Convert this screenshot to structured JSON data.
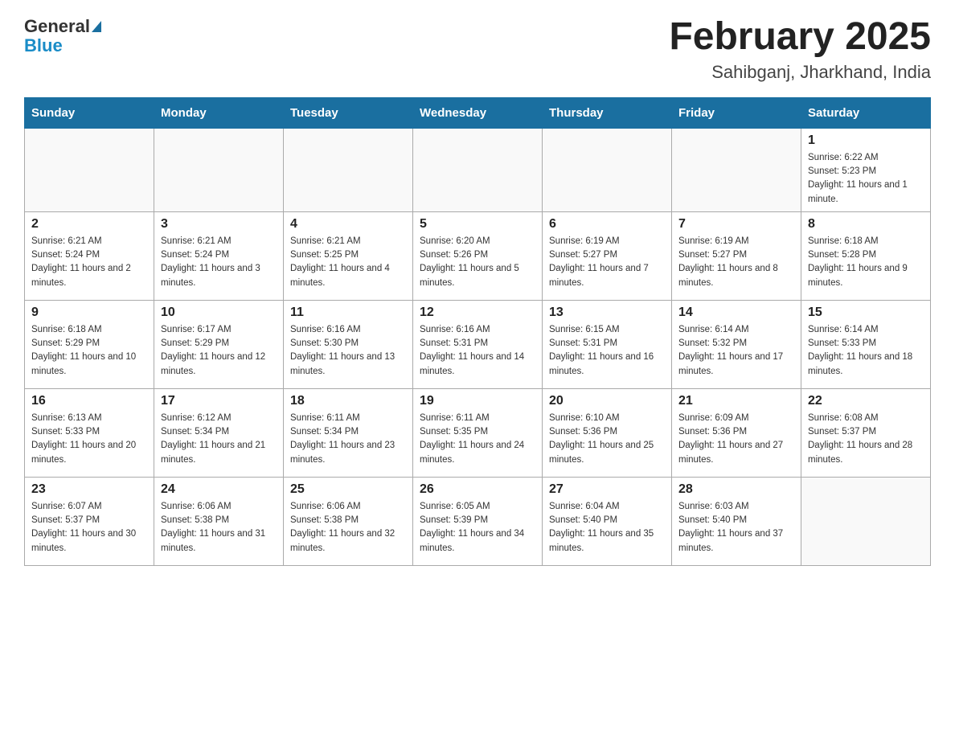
{
  "header": {
    "logo_general": "General",
    "logo_blue": "Blue",
    "month_title": "February 2025",
    "location": "Sahibganj, Jharkhand, India"
  },
  "days_of_week": [
    "Sunday",
    "Monday",
    "Tuesday",
    "Wednesday",
    "Thursday",
    "Friday",
    "Saturday"
  ],
  "weeks": [
    [
      {
        "day": "",
        "sunrise": "",
        "sunset": "",
        "daylight": ""
      },
      {
        "day": "",
        "sunrise": "",
        "sunset": "",
        "daylight": ""
      },
      {
        "day": "",
        "sunrise": "",
        "sunset": "",
        "daylight": ""
      },
      {
        "day": "",
        "sunrise": "",
        "sunset": "",
        "daylight": ""
      },
      {
        "day": "",
        "sunrise": "",
        "sunset": "",
        "daylight": ""
      },
      {
        "day": "",
        "sunrise": "",
        "sunset": "",
        "daylight": ""
      },
      {
        "day": "1",
        "sunrise": "Sunrise: 6:22 AM",
        "sunset": "Sunset: 5:23 PM",
        "daylight": "Daylight: 11 hours and 1 minute."
      }
    ],
    [
      {
        "day": "2",
        "sunrise": "Sunrise: 6:21 AM",
        "sunset": "Sunset: 5:24 PM",
        "daylight": "Daylight: 11 hours and 2 minutes."
      },
      {
        "day": "3",
        "sunrise": "Sunrise: 6:21 AM",
        "sunset": "Sunset: 5:24 PM",
        "daylight": "Daylight: 11 hours and 3 minutes."
      },
      {
        "day": "4",
        "sunrise": "Sunrise: 6:21 AM",
        "sunset": "Sunset: 5:25 PM",
        "daylight": "Daylight: 11 hours and 4 minutes."
      },
      {
        "day": "5",
        "sunrise": "Sunrise: 6:20 AM",
        "sunset": "Sunset: 5:26 PM",
        "daylight": "Daylight: 11 hours and 5 minutes."
      },
      {
        "day": "6",
        "sunrise": "Sunrise: 6:19 AM",
        "sunset": "Sunset: 5:27 PM",
        "daylight": "Daylight: 11 hours and 7 minutes."
      },
      {
        "day": "7",
        "sunrise": "Sunrise: 6:19 AM",
        "sunset": "Sunset: 5:27 PM",
        "daylight": "Daylight: 11 hours and 8 minutes."
      },
      {
        "day": "8",
        "sunrise": "Sunrise: 6:18 AM",
        "sunset": "Sunset: 5:28 PM",
        "daylight": "Daylight: 11 hours and 9 minutes."
      }
    ],
    [
      {
        "day": "9",
        "sunrise": "Sunrise: 6:18 AM",
        "sunset": "Sunset: 5:29 PM",
        "daylight": "Daylight: 11 hours and 10 minutes."
      },
      {
        "day": "10",
        "sunrise": "Sunrise: 6:17 AM",
        "sunset": "Sunset: 5:29 PM",
        "daylight": "Daylight: 11 hours and 12 minutes."
      },
      {
        "day": "11",
        "sunrise": "Sunrise: 6:16 AM",
        "sunset": "Sunset: 5:30 PM",
        "daylight": "Daylight: 11 hours and 13 minutes."
      },
      {
        "day": "12",
        "sunrise": "Sunrise: 6:16 AM",
        "sunset": "Sunset: 5:31 PM",
        "daylight": "Daylight: 11 hours and 14 minutes."
      },
      {
        "day": "13",
        "sunrise": "Sunrise: 6:15 AM",
        "sunset": "Sunset: 5:31 PM",
        "daylight": "Daylight: 11 hours and 16 minutes."
      },
      {
        "day": "14",
        "sunrise": "Sunrise: 6:14 AM",
        "sunset": "Sunset: 5:32 PM",
        "daylight": "Daylight: 11 hours and 17 minutes."
      },
      {
        "day": "15",
        "sunrise": "Sunrise: 6:14 AM",
        "sunset": "Sunset: 5:33 PM",
        "daylight": "Daylight: 11 hours and 18 minutes."
      }
    ],
    [
      {
        "day": "16",
        "sunrise": "Sunrise: 6:13 AM",
        "sunset": "Sunset: 5:33 PM",
        "daylight": "Daylight: 11 hours and 20 minutes."
      },
      {
        "day": "17",
        "sunrise": "Sunrise: 6:12 AM",
        "sunset": "Sunset: 5:34 PM",
        "daylight": "Daylight: 11 hours and 21 minutes."
      },
      {
        "day": "18",
        "sunrise": "Sunrise: 6:11 AM",
        "sunset": "Sunset: 5:34 PM",
        "daylight": "Daylight: 11 hours and 23 minutes."
      },
      {
        "day": "19",
        "sunrise": "Sunrise: 6:11 AM",
        "sunset": "Sunset: 5:35 PM",
        "daylight": "Daylight: 11 hours and 24 minutes."
      },
      {
        "day": "20",
        "sunrise": "Sunrise: 6:10 AM",
        "sunset": "Sunset: 5:36 PM",
        "daylight": "Daylight: 11 hours and 25 minutes."
      },
      {
        "day": "21",
        "sunrise": "Sunrise: 6:09 AM",
        "sunset": "Sunset: 5:36 PM",
        "daylight": "Daylight: 11 hours and 27 minutes."
      },
      {
        "day": "22",
        "sunrise": "Sunrise: 6:08 AM",
        "sunset": "Sunset: 5:37 PM",
        "daylight": "Daylight: 11 hours and 28 minutes."
      }
    ],
    [
      {
        "day": "23",
        "sunrise": "Sunrise: 6:07 AM",
        "sunset": "Sunset: 5:37 PM",
        "daylight": "Daylight: 11 hours and 30 minutes."
      },
      {
        "day": "24",
        "sunrise": "Sunrise: 6:06 AM",
        "sunset": "Sunset: 5:38 PM",
        "daylight": "Daylight: 11 hours and 31 minutes."
      },
      {
        "day": "25",
        "sunrise": "Sunrise: 6:06 AM",
        "sunset": "Sunset: 5:38 PM",
        "daylight": "Daylight: 11 hours and 32 minutes."
      },
      {
        "day": "26",
        "sunrise": "Sunrise: 6:05 AM",
        "sunset": "Sunset: 5:39 PM",
        "daylight": "Daylight: 11 hours and 34 minutes."
      },
      {
        "day": "27",
        "sunrise": "Sunrise: 6:04 AM",
        "sunset": "Sunset: 5:40 PM",
        "daylight": "Daylight: 11 hours and 35 minutes."
      },
      {
        "day": "28",
        "sunrise": "Sunrise: 6:03 AM",
        "sunset": "Sunset: 5:40 PM",
        "daylight": "Daylight: 11 hours and 37 minutes."
      },
      {
        "day": "",
        "sunrise": "",
        "sunset": "",
        "daylight": ""
      }
    ]
  ]
}
